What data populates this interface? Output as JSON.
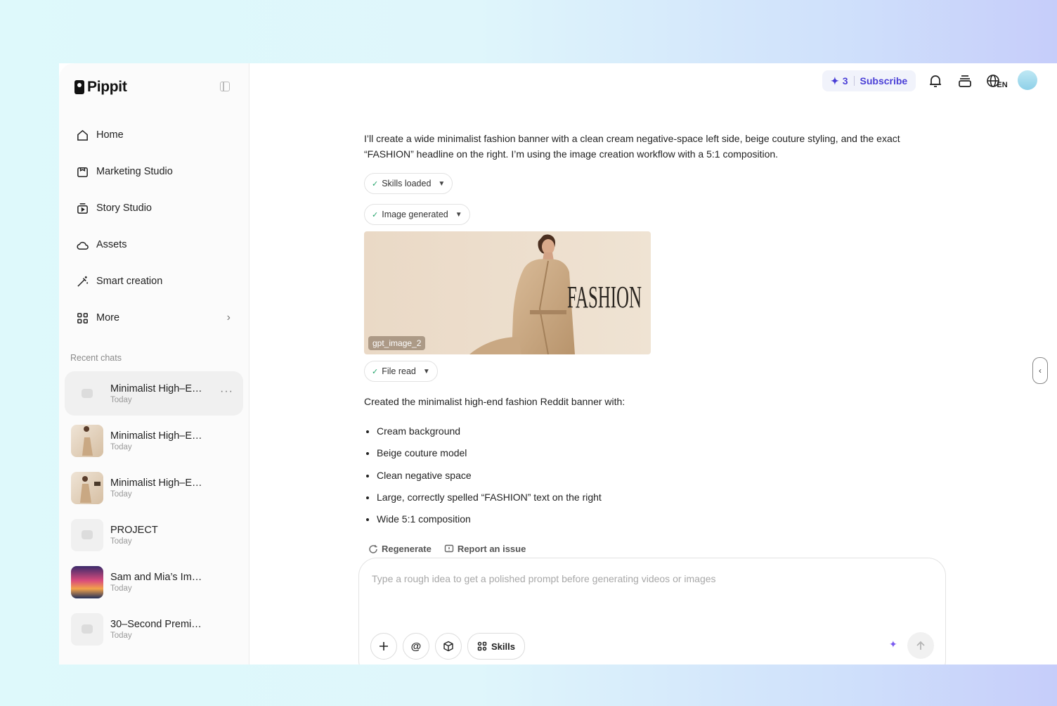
{
  "app": {
    "name": "Pippit"
  },
  "sidebar": {
    "nav": [
      {
        "label": "Home",
        "icon": "home-icon"
      },
      {
        "label": "Marketing Studio",
        "icon": "marketing-icon"
      },
      {
        "label": "Story Studio",
        "icon": "story-icon"
      },
      {
        "label": "Assets",
        "icon": "cloud-icon"
      },
      {
        "label": "Smart creation",
        "icon": "wand-icon"
      },
      {
        "label": "More",
        "icon": "grid-icon"
      }
    ],
    "recent_label": "Recent chats",
    "chats": [
      {
        "title": "Minimalist High–E…",
        "date": "Today",
        "thumb": "placeholder"
      },
      {
        "title": "Minimalist High–E…",
        "date": "Today",
        "thumb": "photo"
      },
      {
        "title": "Minimalist High–E…",
        "date": "Today",
        "thumb": "photo"
      },
      {
        "title": "PROJECT",
        "date": "Today",
        "thumb": "placeholder"
      },
      {
        "title": "Sam and Mia’s Im…",
        "date": "Today",
        "thumb": "concert"
      },
      {
        "title": "30–Second Premi…",
        "date": "Today",
        "thumb": "placeholder"
      }
    ]
  },
  "topbar": {
    "credits": "3",
    "subscribe": "Subscribe",
    "language": "EN"
  },
  "chat": {
    "intro": "I’ll create a wide minimalist fashion banner with a clean cream negative-space left side, beige couture styling, and the exact “FASHION” headline on the right. I’m using the image creation workflow with a 5:1 composition.",
    "chips": {
      "skills": "Skills loaded",
      "image": "Image generated",
      "file": "File read"
    },
    "image": {
      "headline": "FASHION",
      "tag": "gpt_image_2"
    },
    "summary": "Created the minimalist high-end fashion Reddit banner with:",
    "bullets": [
      "Cream background",
      "Beige couture model",
      "Clean negative space",
      "Large, correctly spelled “FASHION” text on the right",
      "Wide 5:1 composition"
    ],
    "actions": {
      "regenerate": "Regenerate",
      "report": "Report an issue"
    }
  },
  "composer": {
    "placeholder": "Type a rough idea to get a polished prompt before generating videos or images",
    "value": "",
    "skills": "Skills"
  },
  "colors": {
    "accent": "#4a3fd6",
    "check": "#22a36a",
    "sparkle": "#7b5cf0"
  }
}
